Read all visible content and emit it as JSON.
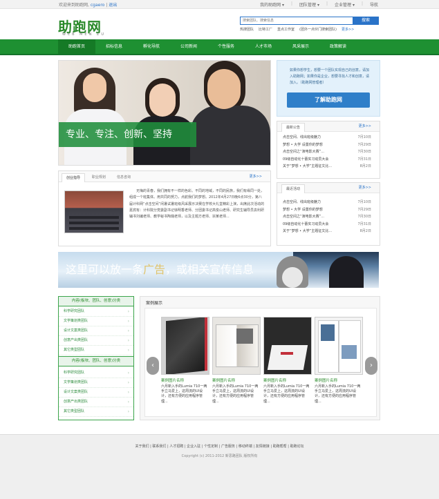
{
  "topbar": {
    "welcome": "欢迎来到助跑网,",
    "user": "cgaero",
    "logout": "退出",
    "menus": [
      "我的助跑网",
      "团队管理",
      "企业管理",
      "导航"
    ]
  },
  "logo": {
    "title": "助跑网",
    "subtitle": "WEB MEN ZU"
  },
  "search": {
    "placeholder": "搜索团队、搜索信息",
    "button": "搜索"
  },
  "hotlinks": [
    "热搜团队",
    "比特工厂",
    "直点工作室",
    "团外一点伙门搜索团队"
  ],
  "hot_more": "更多>>",
  "nav": [
    "助跑首页",
    "招标信息",
    "孵化导航",
    "公司新闻",
    "个性服务",
    "人才市场",
    "风采展示",
    "政策解读"
  ],
  "banner": {
    "slogan": "专业、专注、创新、坚持"
  },
  "promo": {
    "text": "如果你想学生，想要一个团队实现自己的创意，请加入助跑网；如果你是企业，想要寻找人才和创意，请加入。（助跑网管理者）",
    "button": "了解助跑网"
  },
  "news1": {
    "tab": "最新公告",
    "more": "更多>>",
    "items": [
      {
        "title": "点击空间、线出班级魅力",
        "date": "7月10日"
      },
      {
        "title": "梦想 • 大学 设置你的梦想",
        "date": "7月29日"
      },
      {
        "title": "点击空间之“演电影大赛”...",
        "date": "7月30日"
      },
      {
        "title": "09级自动化十蕾实习动员大会",
        "date": "7月31日"
      },
      {
        "title": "关于“梦想 • 大学”主题征文比...",
        "date": "8月2日"
      }
    ]
  },
  "news2": {
    "tab": "最近活动",
    "more": "更多>>",
    "items": [
      {
        "title": "点击空间、线出班级魅力",
        "date": "7月10日"
      },
      {
        "title": "梦想 • 大学 设置你的梦想",
        "date": "7月29日"
      },
      {
        "title": "点击空间之“演电影大赛”...",
        "date": "7月30日"
      },
      {
        "title": "09级自动化十蕾实习动员大会",
        "date": "7月31日"
      },
      {
        "title": "关于“梦想 • 大学”主题征文比...",
        "date": "8月2日"
      }
    ]
  },
  "intro": {
    "tabs": [
      "创业指导",
      "职业规划",
      "信息咨询"
    ],
    "more": "更多>>",
    "text": "无悔的青春，我们拥有不一样的色彩。不同的地域，不同的民族，我们有缘同一处，组成一个班集体。用共同的努力，点航我们的梦想。2012年4月27日晚6点30分，第八届计科网“点击空间”闲暑试暑班级风采展示决赛在学校大礼堂精彩上演，出席此次活动的嘉宾有：计科院分党委副书记徐明香老师、分团委书记高俊山老师、研究生辅导员袁利研辅书刘编老师、教学秘书陶璐老师，以及主题方老师、宗某老师..."
  },
  "ad": {
    "text_before": "这里可以放一条",
    "highlight": "广告",
    "text_after": "，或相关宣传信息"
  },
  "categories": [
    {
      "title": "内容(板块、团队、创意)分类",
      "items": [
        "科学研究团队",
        "文学策划类团队",
        "设计文案类团队",
        "创意产出类团队",
        "其它类型团队"
      ]
    },
    {
      "title": "内容(板块、团队、创意)分类",
      "items": [
        "科学研究团队",
        "文学策划类团队",
        "设计文案类团队",
        "创意产出类团队",
        "其它类型团队"
      ]
    }
  ],
  "cases": {
    "title": "案例展示",
    "items": [
      {
        "name": "案例图片名称",
        "desc": "六月新入手的Lumia 710一两手立马爱上，这周流的UI设计，还有方便的应用程序管理..."
      },
      {
        "name": "案例图片名称",
        "desc": "六月新入手的Lumia 710一两手立马爱上，这周流的UI设计，还有方便的应用程序管理..."
      },
      {
        "name": "案例图片名称",
        "desc": "六月新入手的Lumia 710一两手立马爱上，这周流的UI设计，还有方便的应用程序管理..."
      },
      {
        "name": "案例图片名称",
        "desc": "六月新入手的Lumia 710一两手立马爱上，这周流的UI设计，还有方便的应用程序管理..."
      }
    ]
  },
  "footer": {
    "links": [
      "关于我们",
      "联系我们",
      "人才招聘",
      "企业入驻",
      "个性定制",
      "广告服务",
      "移动终端",
      "友情链接",
      "助跑帮帮",
      "助跑论坛"
    ],
    "copyright": "Copyright (c) 2011-2012 新思路团队 版权所有"
  },
  "colors": {
    "brand_green": "#1e9032",
    "accent_blue": "#2a73c8"
  }
}
